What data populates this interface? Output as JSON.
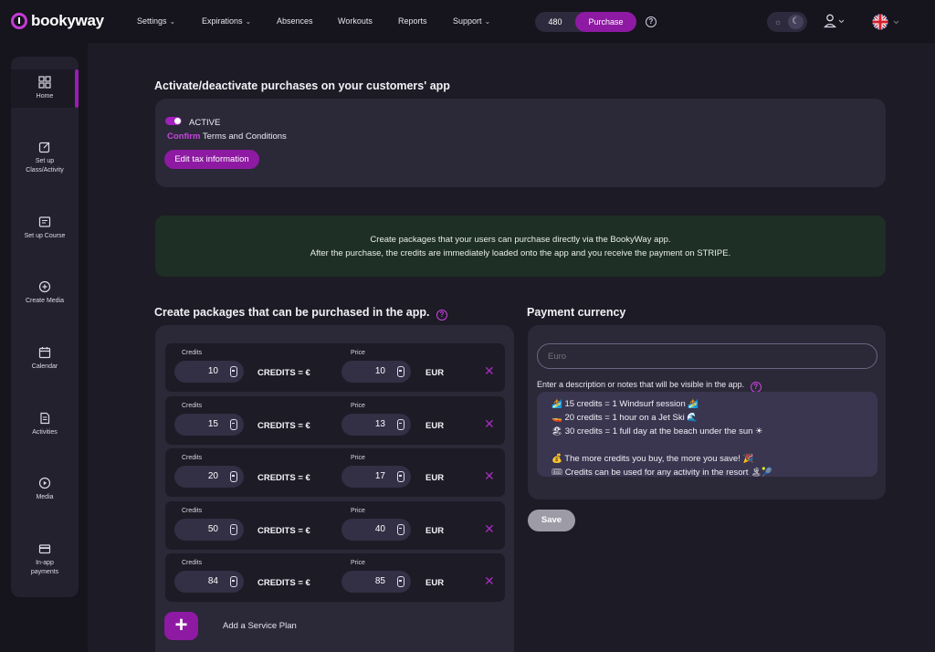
{
  "brand": {
    "name": "bookyway"
  },
  "nav": [
    {
      "label": "Settings",
      "has_caret": true
    },
    {
      "label": "Expirations",
      "has_caret": true
    },
    {
      "label": "Absences",
      "has_caret": false
    },
    {
      "label": "Workouts",
      "has_caret": false
    },
    {
      "label": "Reports",
      "has_caret": false
    },
    {
      "label": "Support",
      "has_caret": true
    }
  ],
  "header": {
    "credit_count": "480",
    "purchase_label": "Purchase",
    "help_glyph": "?",
    "theme": {
      "sun_icon": "sun-icon",
      "moon_icon": "moon-icon",
      "selected": "dark"
    },
    "language_flag": "uk-flag-icon"
  },
  "sidebar": [
    {
      "label": "Home",
      "icon": "home-icon",
      "active": true
    },
    {
      "label": "Set up Class/Activity",
      "icon": "edit-icon",
      "active": false
    },
    {
      "label": "Set up Course",
      "icon": "course-icon",
      "active": false
    },
    {
      "label": "Create Media",
      "icon": "plus-circle-icon",
      "active": false
    },
    {
      "label": "Calendar",
      "icon": "calendar-icon",
      "active": false
    },
    {
      "label": "Activities",
      "icon": "document-icon",
      "active": false
    },
    {
      "label": "Media",
      "icon": "play-icon",
      "active": false
    },
    {
      "label": "In-app payments",
      "icon": "card-icon",
      "active": false
    }
  ],
  "purchases": {
    "title": "Activate/deactivate purchases on your customers' app",
    "status_label": "ACTIVE",
    "enabled": true,
    "confirm_label": "Confirm",
    "terms_label": "Terms and Conditions",
    "tax_button": "Edit tax information"
  },
  "info_banner": {
    "line1": "Create packages that your users can purchase directly via the BookyWay app.",
    "line2": "After the purchase, the credits are immediately loaded onto the app and you receive the payment on STRIPE."
  },
  "packages": {
    "title": "Create packages that can be purchased in the app.",
    "credits_label": "Credits",
    "price_label": "Price",
    "equals_label": "CREDITS = €",
    "currency_label": "EUR",
    "rows": [
      {
        "credits": "10",
        "price": "10"
      },
      {
        "credits": "15",
        "price": "13"
      },
      {
        "credits": "20",
        "price": "17"
      },
      {
        "credits": "50",
        "price": "40"
      },
      {
        "credits": "84",
        "price": "85"
      }
    ],
    "add_glyph": "+",
    "add_label": "Add a Service Plan"
  },
  "payment": {
    "title": "Payment currency",
    "currency_placeholder": "Euro",
    "desc_label": "Enter a description or notes that will be visible in the app.",
    "desc_lines": [
      "🏄 15 credits = 1 Windsurf session 🏄",
      "🚤 20 credits = 1 hour on a Jet Ski 🌊",
      "🏖 30 credits = 1 full day at the beach under the sun ☀",
      "",
      "💰 The more credits you buy, the more you save! 🎉",
      "🎟 Credits can be used for any activity in the resort 🏝🎾"
    ],
    "save_button": "Save"
  },
  "colors": {
    "accent": "#8e1aa3",
    "background": "#16141c",
    "panel": "#2b2838",
    "banner": "#1e2f26"
  }
}
